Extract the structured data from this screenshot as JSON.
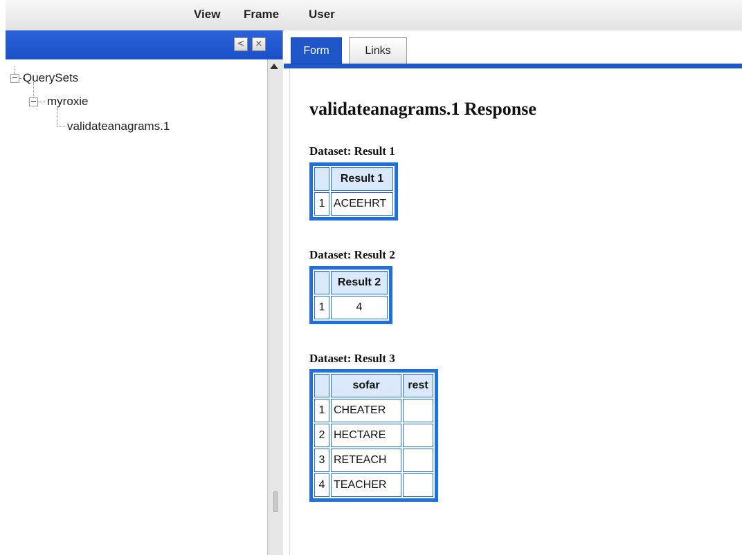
{
  "menubar": {
    "items": [
      "View",
      "Frame",
      "User"
    ]
  },
  "left_panel": {
    "collapse_button": "<",
    "close_button": "×",
    "tree": {
      "root": {
        "label": "QuerySets",
        "toggle": "−"
      },
      "child": {
        "label": "myroxie",
        "toggle": "−"
      },
      "leaf": {
        "label": "validateanagrams.1"
      }
    }
  },
  "right_panel": {
    "tabs": [
      {
        "label": "Form",
        "active": true
      },
      {
        "label": "Links",
        "active": false
      }
    ],
    "response_title": "validateanagrams.1 Response",
    "datasets": [
      {
        "label": "Dataset: Result 1",
        "columns": [
          "Result 1"
        ],
        "rows": [
          {
            "index": "1",
            "cells": [
              "ACEEHRT"
            ]
          }
        ]
      },
      {
        "label": "Dataset: Result 2",
        "columns": [
          "Result 2"
        ],
        "rows": [
          {
            "index": "1",
            "cells": [
              "4"
            ]
          }
        ]
      },
      {
        "label": "Dataset: Result 3",
        "columns": [
          "sofar",
          "rest"
        ],
        "rows": [
          {
            "index": "1",
            "cells": [
              "CHEATER",
              ""
            ]
          },
          {
            "index": "2",
            "cells": [
              "HECTARE",
              ""
            ]
          },
          {
            "index": "3",
            "cells": [
              "RETEACH",
              ""
            ]
          },
          {
            "index": "4",
            "cells": [
              "TEACHER",
              ""
            ]
          }
        ]
      }
    ]
  },
  "colors": {
    "panel_header": "#1b4fc9",
    "table_border": "#1f6fe0",
    "table_header_bg": "#d9e8fa",
    "active_tab": "#1f57c9"
  }
}
